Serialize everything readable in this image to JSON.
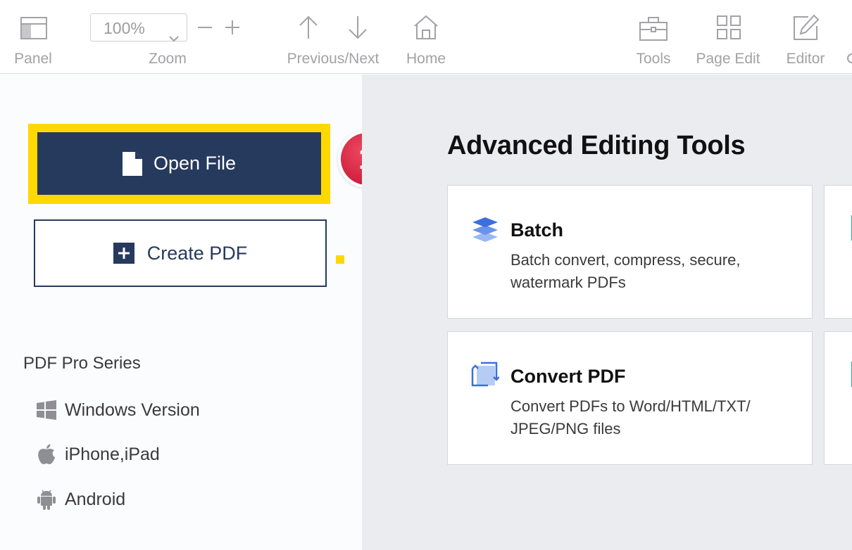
{
  "toolbar": {
    "panel_label": "Panel",
    "zoom_label": "Zoom",
    "zoom_value": "100%",
    "prevnext_label": "Previous/Next",
    "home_label": "Home",
    "tools_label": "Tools",
    "page_edit_label": "Page Edit",
    "editor_label": "Editor"
  },
  "sidebar": {
    "open_file_label": "Open File",
    "create_pdf_label": "Create PDF",
    "step_number": "1",
    "series_title": "PDF Pro Series",
    "platforms": [
      {
        "label": "Windows Version",
        "icon": "windows-icon"
      },
      {
        "label": "iPhone,iPad",
        "icon": "apple-icon"
      },
      {
        "label": "Android",
        "icon": "android-icon"
      }
    ]
  },
  "main": {
    "section_title": "Advanced Editing Tools",
    "cards": [
      {
        "title": "Batch",
        "description": "Batch convert, compress, secure, watermark PDFs",
        "icon": "layers-icon"
      },
      {
        "title": "Convert PDF",
        "description": "Convert PDFs to Word/HTML/TXT/ JPEG/PNG files",
        "icon": "convert-icon"
      }
    ]
  },
  "colors": {
    "primary_navy": "#263a5e",
    "highlight_yellow": "#ffd800",
    "badge_red": "#d01f3c",
    "accent_blue": "#3b6fe0",
    "accent_green": "#1fb187"
  }
}
